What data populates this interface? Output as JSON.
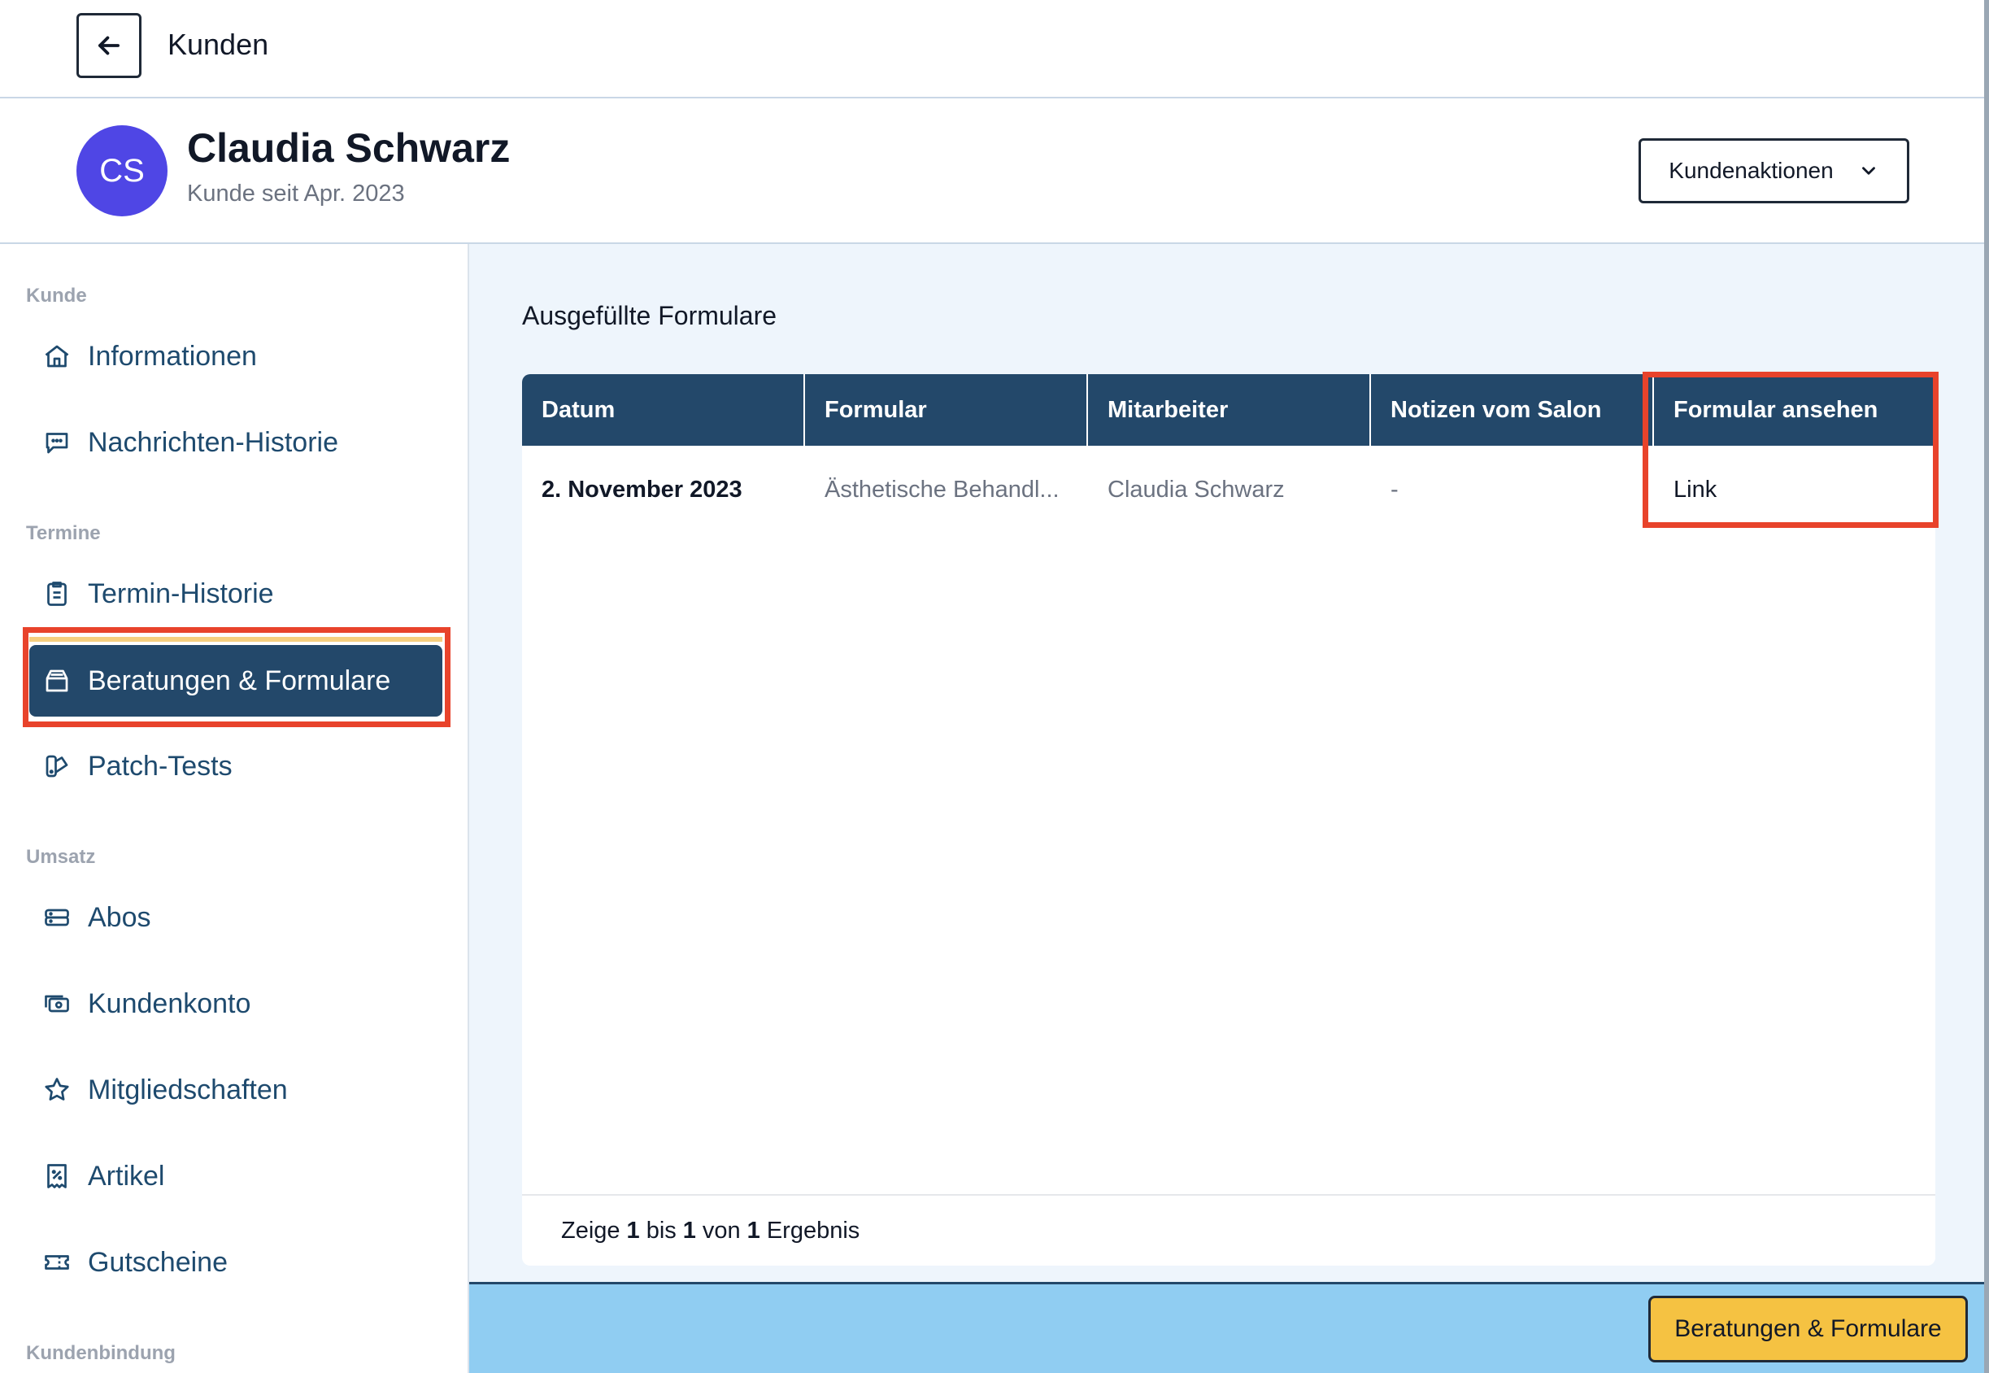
{
  "topbar": {
    "title": "Kunden"
  },
  "customer": {
    "initials": "CS",
    "name": "Claudia Schwarz",
    "since": "Kunde seit Apr. 2023",
    "actions_label": "Kundenaktionen"
  },
  "sidebar": {
    "sections": {
      "kunde": "Kunde",
      "termine": "Termine",
      "umsatz": "Umsatz",
      "kundenbindung": "Kundenbindung"
    },
    "items": {
      "informationen": "Informationen",
      "nachrichten": "Nachrichten-Historie",
      "termin_historie": "Termin-Historie",
      "beratungen": "Beratungen & Formulare",
      "patch_tests": "Patch-Tests",
      "abos": "Abos",
      "kundenkonto": "Kundenkonto",
      "mitgliedschaften": "Mitgliedschaften",
      "artikel": "Artikel",
      "gutscheine": "Gutscheine"
    }
  },
  "main": {
    "title": "Ausgefüllte Formulare",
    "columns": [
      "Datum",
      "Formular",
      "Mitarbeiter",
      "Notizen vom Salon",
      "Formular ansehen"
    ],
    "rows": [
      [
        "2. November 2023",
        "Ästhetische Behandl...",
        "Claudia Schwarz",
        "-",
        "Link"
      ]
    ],
    "footer": {
      "prefix": "Zeige",
      "from": "1",
      "mid1": "bis",
      "to": "1",
      "mid2": "von",
      "total": "1",
      "suffix": "Ergebnis"
    }
  },
  "bottom": {
    "button_label": "Beratungen & Formulare"
  },
  "colors": {
    "accent": "#23486a",
    "highlight": "#e8432b",
    "bottom_button": "#f5c242",
    "avatar": "#4f46e5"
  }
}
